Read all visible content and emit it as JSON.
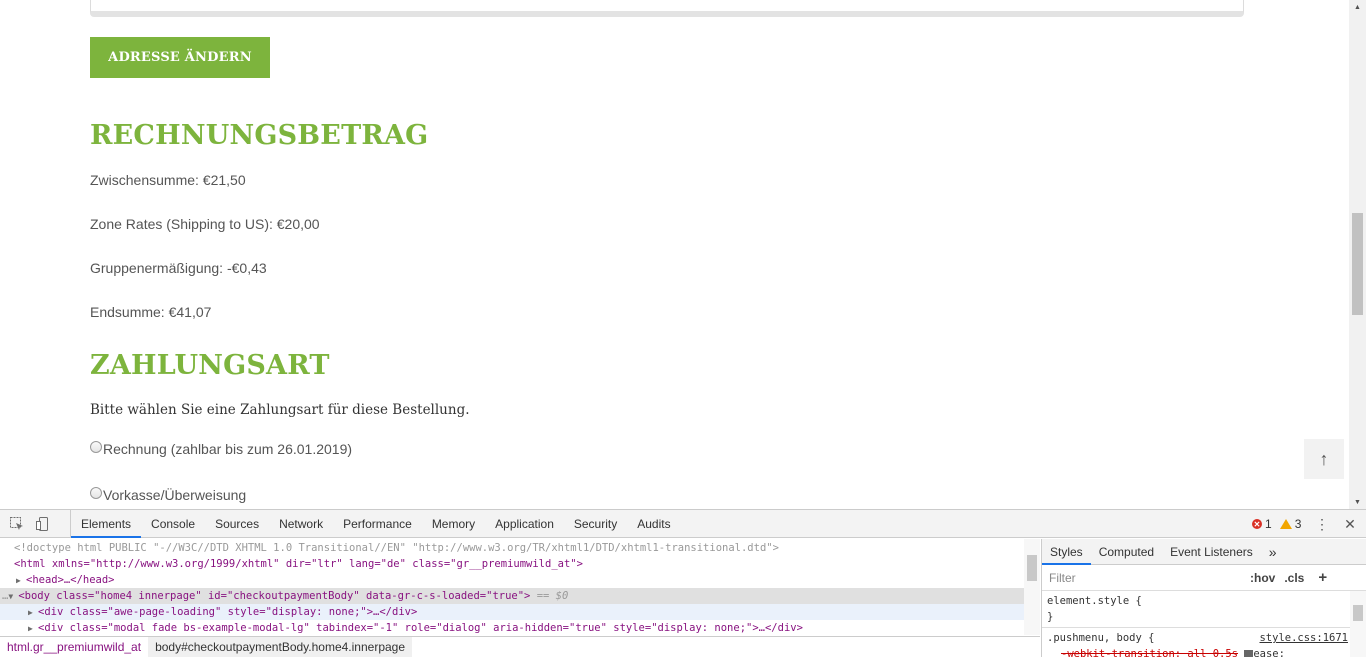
{
  "page": {
    "address_button": "ADRESSE ÄNDERN",
    "billing_heading": "RECHNUNGSBETRAG",
    "totals": [
      "Zwischensumme: €21,50",
      "Zone Rates (Shipping to US): €20,00",
      "Gruppenermäßigung: -€0,43",
      "Endsumme: €41,07"
    ],
    "payment_heading": "ZAHLUNGSART",
    "payment_intro": "Bitte wählen Sie eine Zahlungsart für diese Bestellung.",
    "payment_options": [
      "Rechnung (zahlbar bis zum 26.01.2019)",
      "Vorkasse/Überweisung"
    ],
    "back_to_top": "↑",
    "accent_color": "#7db43d"
  },
  "devtools": {
    "tabs": [
      "Elements",
      "Console",
      "Sources",
      "Network",
      "Performance",
      "Memory",
      "Application",
      "Security",
      "Audits"
    ],
    "active_tab": "Elements",
    "error_count": "1",
    "warning_count": "3",
    "dom": {
      "doctype": "<!doctype html PUBLIC \"-//W3C//DTD XHTML 1.0 Transitional//EN\" \"http://www.w3.org/TR/xhtml1/DTD/xhtml1-transitional.dtd\">",
      "html_open": "<html xmlns=\"http://www.w3.org/1999/xhtml\" dir=\"ltr\" lang=\"de\" class=\"gr__premiumwild_at\">",
      "head": "<head>…</head>",
      "body_open": "<body class=\"home4 innerpage\" id=\"checkoutpaymentBody\" data-gr-c-s-loaded=\"true\">",
      "body_marker": "== $0",
      "div_loading": "<div class=\"awe-page-loading\" style=\"display: none;\">…</div>",
      "div_modal": "<div class=\"modal fade bs-example-modal-lg\" tabindex=\"-1\" role=\"dialog\" aria-hidden=\"true\" style=\"display: none;\">…</div>"
    },
    "breadcrumbs": [
      "html.gr__premiumwild_at",
      "body#checkoutpaymentBody.home4.innerpage"
    ],
    "styles": {
      "tabs": [
        "Styles",
        "Computed",
        "Event Listeners"
      ],
      "more": "»",
      "filter_placeholder": "Filter",
      "hov": ":hov",
      "cls": ".cls",
      "add": "+",
      "element_style_open": "element.style {",
      "element_style_close": "}",
      "rule_selector": ".pushmenu, body {",
      "rule_source": "style.css:1671",
      "rule_property": "-webkit-transition: all 0.5s",
      "rule_value_tail": "ease;"
    }
  }
}
